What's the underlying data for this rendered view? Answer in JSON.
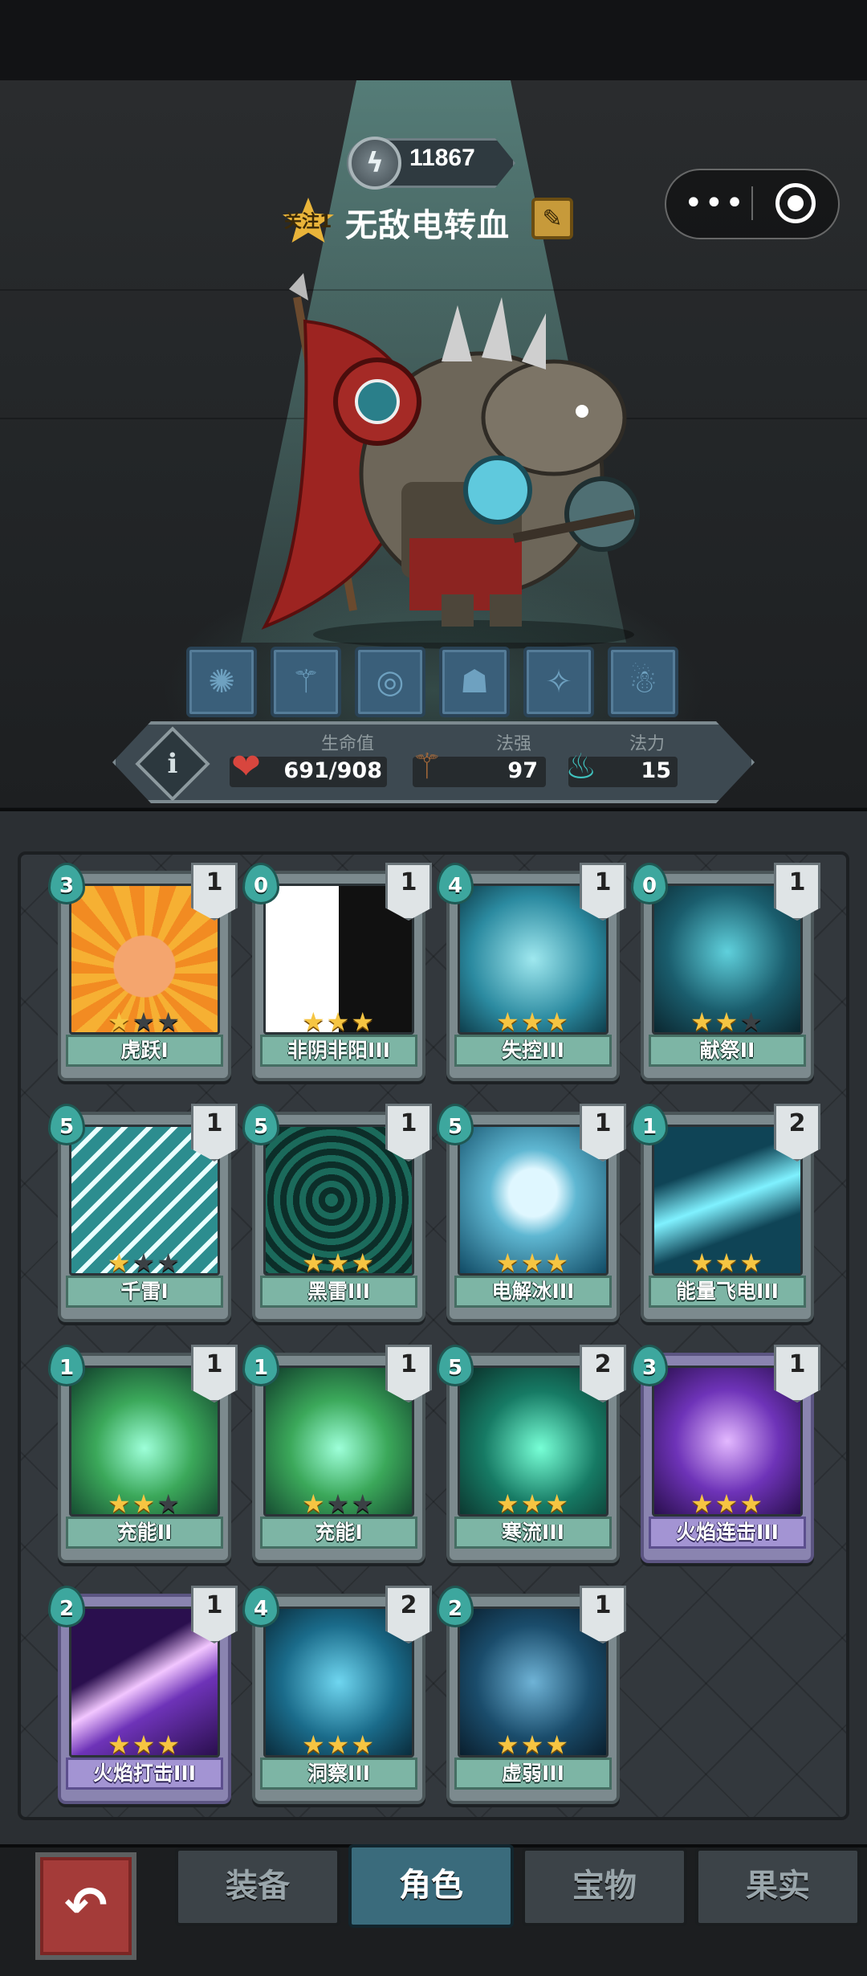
{
  "player": {
    "power": "11867",
    "follow_label": "关注1",
    "name": "无敌电转血"
  },
  "stats": {
    "hp_label": "生命值",
    "hp_value": "691/908",
    "magic_power_label": "法强",
    "magic_power_value": "97",
    "mana_label": "法力",
    "mana_value": "15"
  },
  "skills_equipped": [
    "spiky-ball-icon",
    "staff-icon",
    "tornado-icon",
    "helmet-icon",
    "rune-icon",
    "creature-icon"
  ],
  "cards": [
    {
      "name": "虎跃I",
      "cost": "3",
      "level": "1",
      "stars": 1,
      "theme": "green",
      "art": "tiger"
    },
    {
      "name": "非阴非阳III",
      "cost": "0",
      "level": "1",
      "stars": 3,
      "theme": "green",
      "art": "yinyang"
    },
    {
      "name": "失控III",
      "cost": "4",
      "level": "1",
      "stars": 3,
      "theme": "green",
      "art": "claw"
    },
    {
      "name": "献祭II",
      "cost": "0",
      "level": "1",
      "stars": 2,
      "theme": "green",
      "art": "ghost"
    },
    {
      "name": "千雷I",
      "cost": "5",
      "level": "1",
      "stars": 1,
      "theme": "green",
      "art": "bolts"
    },
    {
      "name": "黑雷III",
      "cost": "5",
      "level": "1",
      "stars": 3,
      "theme": "green",
      "art": "swirl"
    },
    {
      "name": "电解冰III",
      "cost": "5",
      "level": "1",
      "stars": 3,
      "theme": "green",
      "art": "ice"
    },
    {
      "name": "能量飞电III",
      "cost": "1",
      "level": "2",
      "stars": 3,
      "theme": "green",
      "art": "beam"
    },
    {
      "name": "充能II",
      "cost": "1",
      "level": "1",
      "stars": 2,
      "theme": "green",
      "art": "charge"
    },
    {
      "name": "充能I",
      "cost": "1",
      "level": "1",
      "stars": 1,
      "theme": "green",
      "art": "charge"
    },
    {
      "name": "寒流III",
      "cost": "5",
      "level": "2",
      "stars": 3,
      "theme": "green",
      "art": "wave"
    },
    {
      "name": "火焰连击III",
      "cost": "3",
      "level": "1",
      "stars": 3,
      "theme": "purple",
      "art": "purplefire"
    },
    {
      "name": "火焰打击III",
      "cost": "2",
      "level": "1",
      "stars": 3,
      "theme": "purple",
      "art": "purplestrike"
    },
    {
      "name": "洞察III",
      "cost": "4",
      "level": "2",
      "stars": 3,
      "theme": "green",
      "art": "body"
    },
    {
      "name": "虚弱III",
      "cost": "2",
      "level": "1",
      "stars": 3,
      "theme": "green",
      "art": "shield"
    }
  ],
  "nav": {
    "tabs": [
      "装备",
      "角色",
      "宝物",
      "果实"
    ],
    "active": "角色"
  },
  "colors": {
    "accent": "#3da79e",
    "star": "#f6c542",
    "back": "#a43b39"
  }
}
